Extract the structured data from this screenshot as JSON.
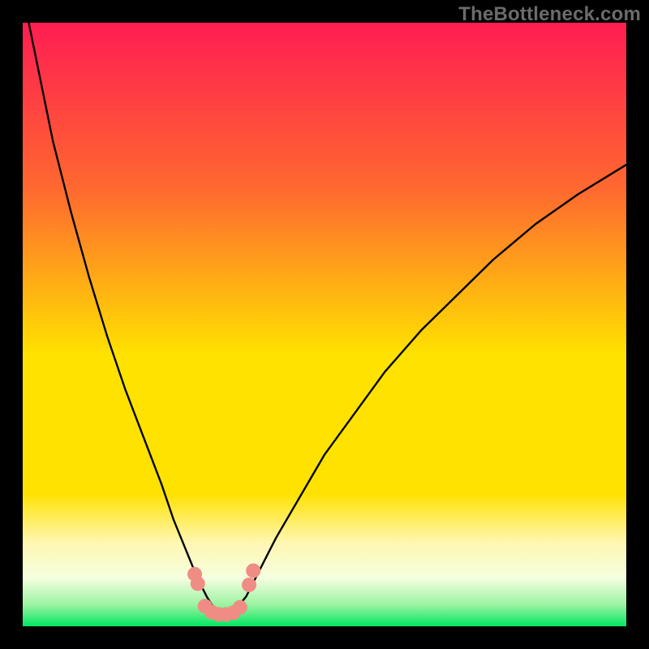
{
  "watermark": "TheBottleneck.com",
  "chart_data": {
    "type": "line",
    "title": "",
    "xlabel": "",
    "ylabel": "",
    "xlim": [
      0,
      100
    ],
    "ylim": [
      -2,
      100
    ],
    "background_gradient": {
      "top": "#ff1d52",
      "mid": "#ffe200",
      "bottom": "#00e763",
      "pale_band_start_y": 20,
      "pale_band_end_y": 0
    },
    "series": [
      {
        "name": "bottleneck-curve",
        "x": [
          1,
          3,
          5,
          8,
          11,
          14,
          17,
          20,
          23,
          25,
          27,
          29,
          30.5,
          32,
          33.5,
          35,
          37,
          39,
          42,
          46,
          50,
          55,
          60,
          66,
          72,
          78,
          85,
          92,
          100
        ],
        "y": [
          100,
          90,
          80,
          68,
          57,
          47,
          38,
          30,
          22,
          16,
          11,
          6,
          3,
          0.5,
          0,
          0.5,
          3,
          7,
          13,
          20,
          27,
          34,
          41,
          48,
          54,
          60,
          66,
          71,
          76
        ]
      }
    ],
    "markers": {
      "name": "sample-dots",
      "color": "#ef8d84",
      "points": [
        {
          "x": 28.5,
          "y": 6.8
        },
        {
          "x": 29.0,
          "y": 5.2
        },
        {
          "x": 30.2,
          "y": 1.4
        },
        {
          "x": 31.3,
          "y": 0.4
        },
        {
          "x": 32.5,
          "y": 0.0
        },
        {
          "x": 33.7,
          "y": 0.0
        },
        {
          "x": 34.9,
          "y": 0.3
        },
        {
          "x": 36.0,
          "y": 1.2
        },
        {
          "x": 37.5,
          "y": 5.0
        },
        {
          "x": 38.2,
          "y": 7.4
        }
      ]
    }
  }
}
